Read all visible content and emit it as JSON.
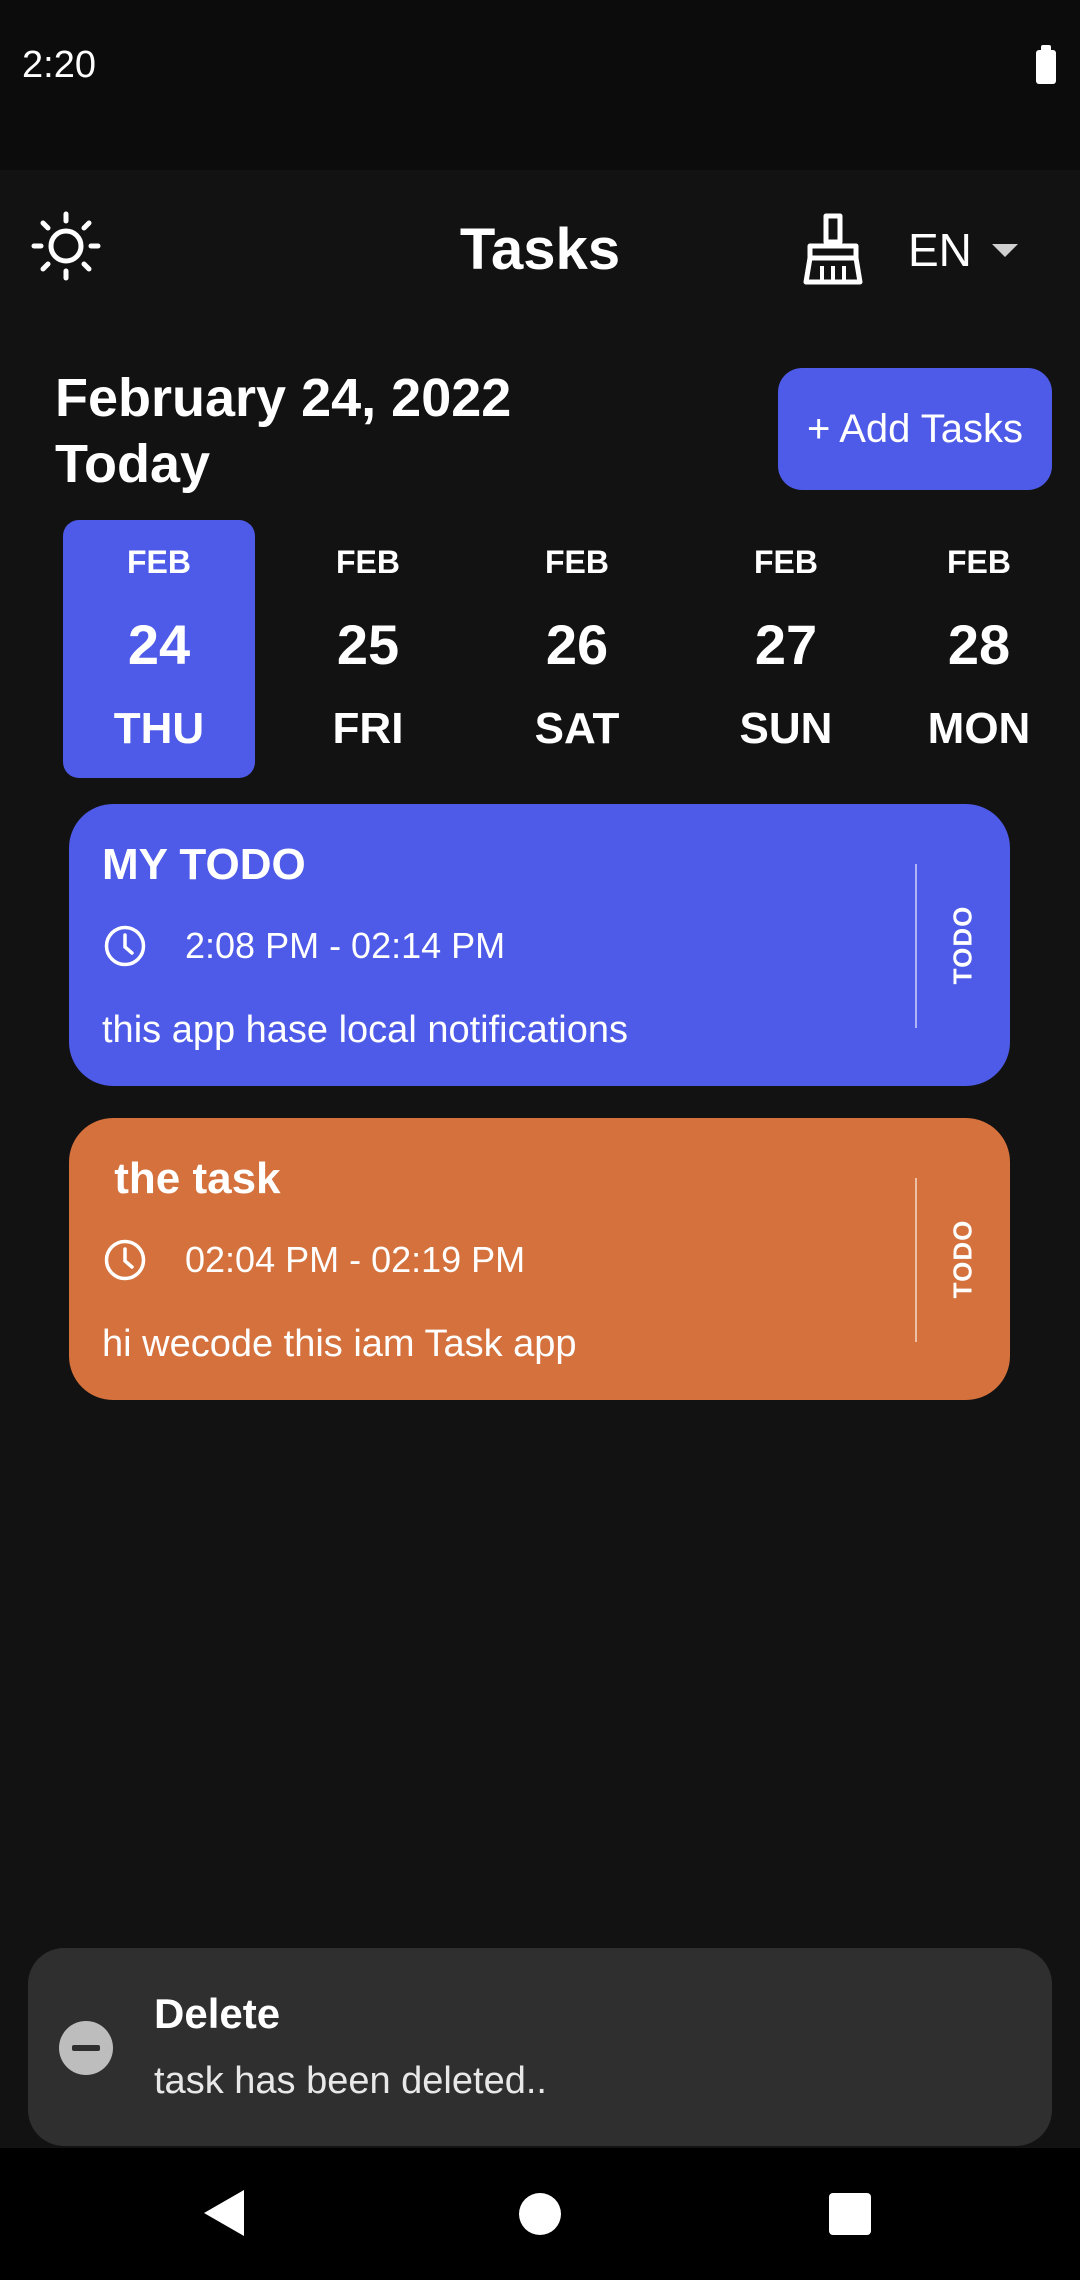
{
  "status_bar": {
    "time": "2:20"
  },
  "app_bar": {
    "title": "Tasks",
    "language": "EN",
    "icons": [
      "sun-icon",
      "broom-icon",
      "caret-down-icon"
    ]
  },
  "header": {
    "date": "February 24, 2022",
    "day_label": "Today",
    "add_button_label": "+ Add Tasks"
  },
  "date_strip": [
    {
      "month": "FEB",
      "day": "24",
      "weekday": "THU",
      "selected": true
    },
    {
      "month": "FEB",
      "day": "25",
      "weekday": "FRI",
      "selected": false
    },
    {
      "month": "FEB",
      "day": "26",
      "weekday": "SAT",
      "selected": false
    },
    {
      "month": "FEB",
      "day": "27",
      "weekday": "SUN",
      "selected": false
    },
    {
      "month": "FEB",
      "day": "28",
      "weekday": "MON",
      "selected": false
    }
  ],
  "tasks": [
    {
      "title": "MY TODO",
      "time": "2:08 PM - 02:14 PM",
      "note": "this app hase local notifications",
      "status": "TODO",
      "color": "#4e5ae8"
    },
    {
      "title": " the task",
      "time": "02:04 PM - 02:19 PM",
      "note": "hi wecode this iam Task app",
      "status": "TODO",
      "color": "#d4713d"
    }
  ],
  "snackbar": {
    "title": "Delete",
    "message": "task has been deleted.."
  },
  "colors": {
    "background": "#121212",
    "accent": "#4e5ae8",
    "orange": "#d4713d",
    "snackbar": "#2f2f2f"
  }
}
